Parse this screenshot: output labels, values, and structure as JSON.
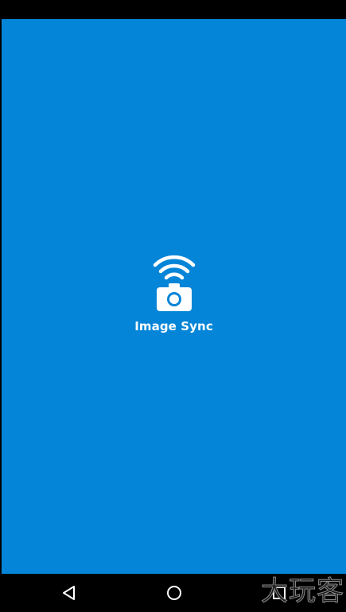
{
  "app": {
    "name": "Image Sync",
    "logo_icon": "wifi-camera-icon"
  },
  "colors": {
    "splash_background": "#0585d8",
    "bars": "#000000",
    "foreground": "#ffffff"
  },
  "navigation": {
    "back_icon": "back-triangle-icon",
    "home_icon": "home-circle-icon",
    "recents_icon": "recents-square-icon"
  },
  "watermark": {
    "text": "大玩客"
  }
}
